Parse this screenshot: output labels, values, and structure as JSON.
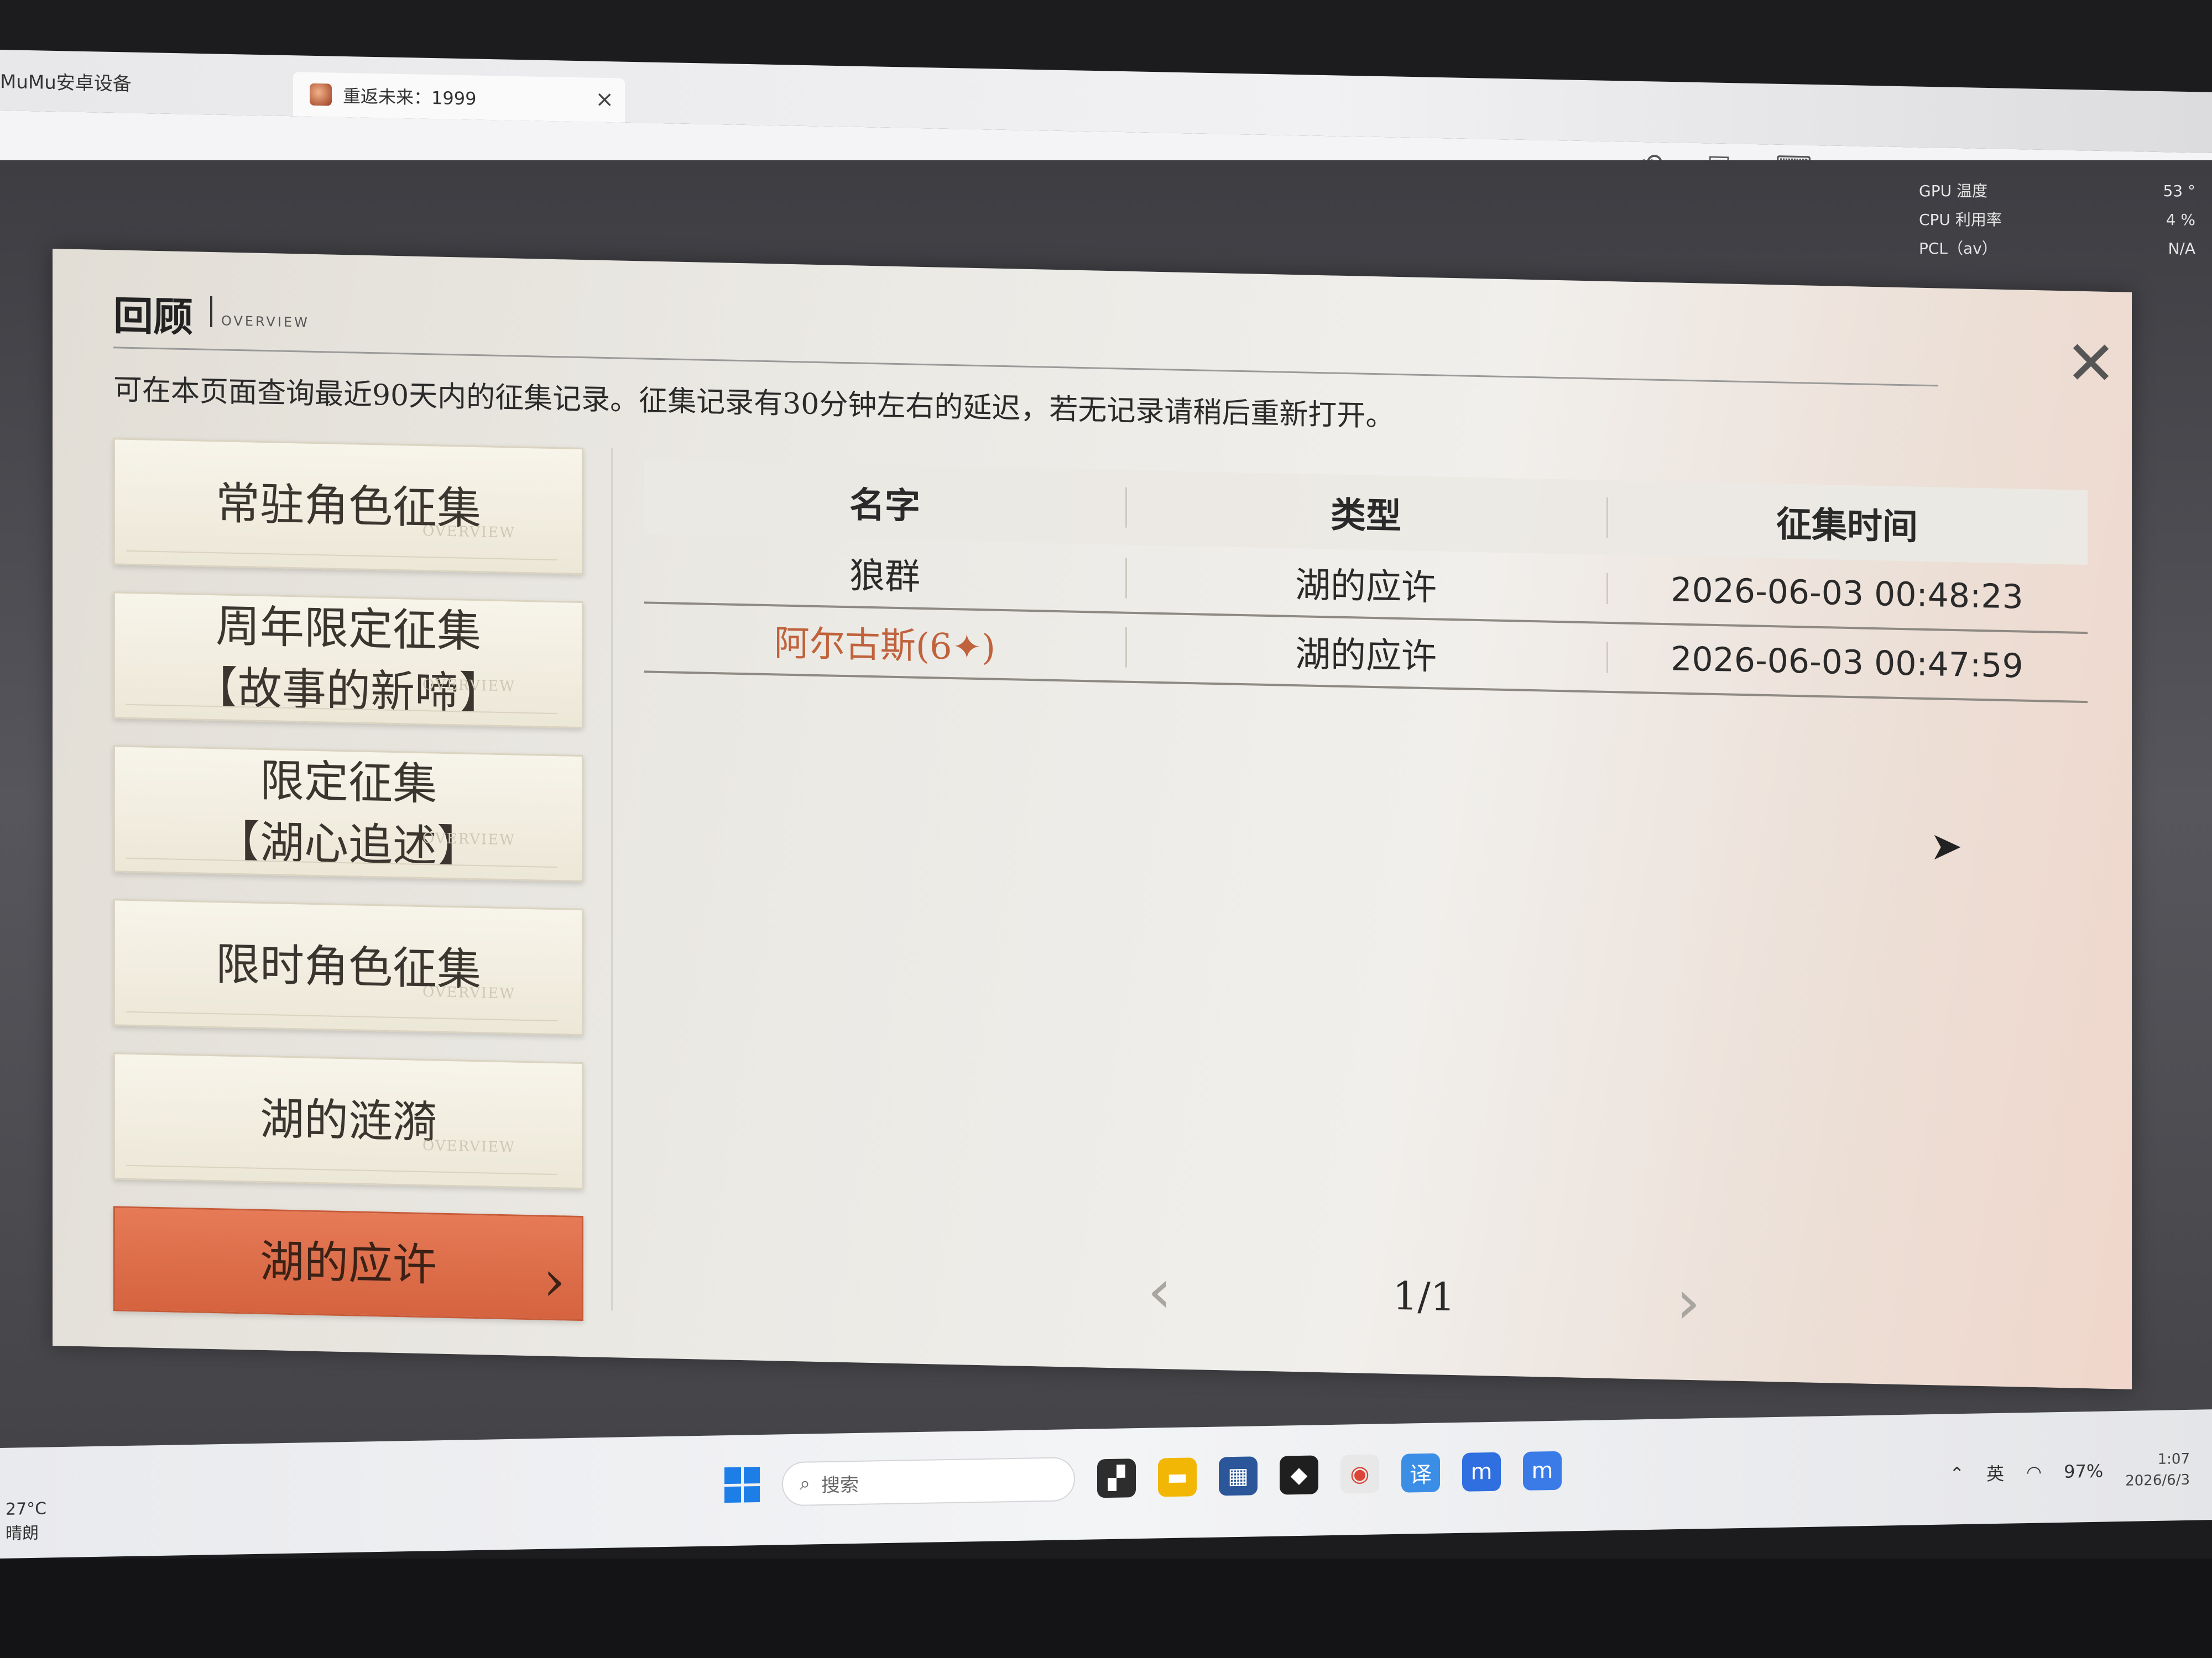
{
  "emulator": {
    "app_name": "MuMu安卓设备",
    "tab_title": "重返未来：1999",
    "tab_close": "×",
    "toolbar_icons": [
      "history-icon",
      "screen-record-icon",
      "keyboard-icon",
      "volume-icon",
      "back-icon",
      "more-icon",
      "minimize-icon",
      "restore-icon"
    ]
  },
  "perf_overlay": [
    {
      "label": "GPU 温度",
      "value": "53 °"
    },
    {
      "label": "CPU 利用率",
      "value": "4 %"
    },
    {
      "label": "PCL（av）",
      "value": "N/A"
    }
  ],
  "panel": {
    "title": "回顾",
    "subtitle": "OVERVIEW",
    "close": "✕",
    "description": "可在本页面查询最近90天内的征集记录。征集记录有30分钟左右的延迟，若无记录请稍后重新打开。"
  },
  "pool_tabs": [
    {
      "label": "常驻角色征集",
      "watermark": "OVERVIEW"
    },
    {
      "label": "周年限定征集\n【故事的新啼】",
      "watermark": "OVERVIEW"
    },
    {
      "label": "限定征集\n【湖心追述】",
      "watermark": "OVERVIEW"
    },
    {
      "label": "限时角色征集",
      "watermark": "OVERVIEW"
    },
    {
      "label": "湖的涟漪",
      "watermark": "OVERVIEW"
    },
    {
      "label": "湖的应许",
      "watermark": ""
    }
  ],
  "table": {
    "headers": [
      "名字",
      "类型",
      "征集时间"
    ],
    "rows": [
      {
        "name": "狼群",
        "type": "湖的应许",
        "time": "2026-06-03 00:48:23",
        "rare": false
      },
      {
        "name": "阿尔古斯(6✦)",
        "type": "湖的应许",
        "time": "2026-06-03 00:47:59",
        "rare": true
      }
    ]
  },
  "pager": {
    "prev": "‹",
    "text": "1/1",
    "next": "›"
  },
  "taskbar": {
    "weather_temp": "27°C",
    "weather_desc": "晴朗",
    "search_placeholder": "搜索",
    "tray_lang": "英",
    "battery": "97%",
    "clock_time": "1:07",
    "clock_date": "2026/6/3"
  },
  "colors": {
    "accent": "#d5633f",
    "rare_name": "#c0623c"
  }
}
